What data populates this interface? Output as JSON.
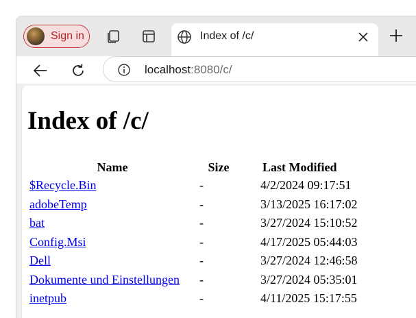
{
  "browser": {
    "profile_label": "Sign in",
    "tab_title": "Index of /c/",
    "url_host": "localhost",
    "url_rest": ":8080/c/"
  },
  "page": {
    "heading": "Index of /c/",
    "columns": [
      "Name",
      "Size",
      "Last Modified"
    ],
    "rows": [
      {
        "name": "$Recycle.Bin",
        "size": "-",
        "modified": "4/2/2024 09:17:51"
      },
      {
        "name": "adobeTemp",
        "size": "-",
        "modified": "3/13/2025 16:17:02"
      },
      {
        "name": "bat",
        "size": "-",
        "modified": "3/27/2024 15:10:52"
      },
      {
        "name": "Config.Msi",
        "size": "-",
        "modified": "4/17/2025 05:44:03"
      },
      {
        "name": "Dell",
        "size": "-",
        "modified": "3/27/2024 12:46:58"
      },
      {
        "name": "Dokumente und Einstellungen",
        "size": "-",
        "modified": "3/27/2024 05:35:01"
      },
      {
        "name": "inetpub",
        "size": "-",
        "modified": "4/11/2025 15:17:55"
      }
    ]
  }
}
